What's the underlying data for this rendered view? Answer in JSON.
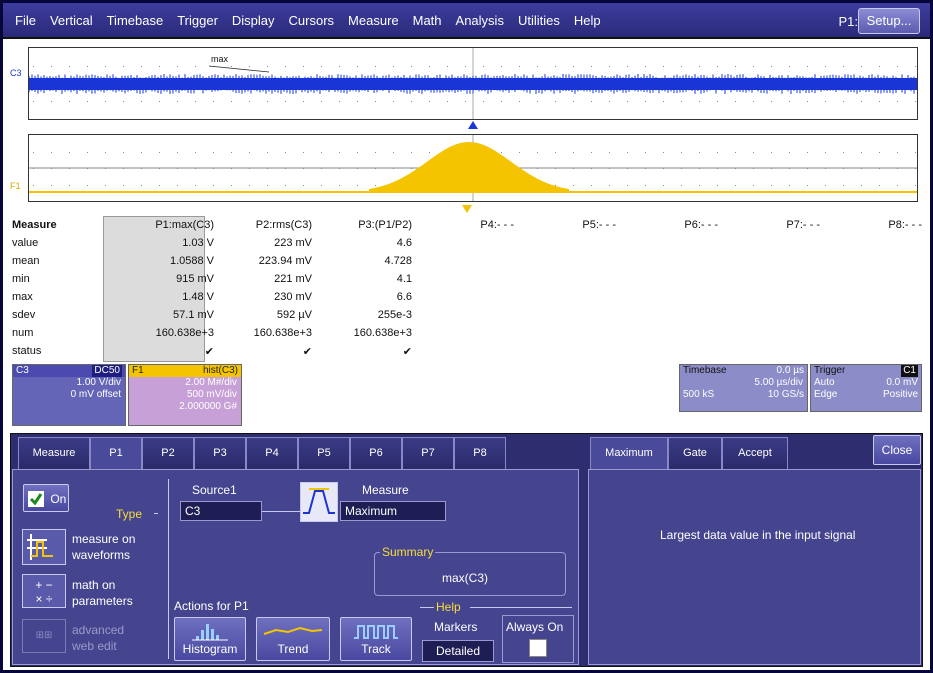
{
  "menu": {
    "items": [
      "File",
      "Vertical",
      "Timebase",
      "Trigger",
      "Display",
      "Cursors",
      "Measure",
      "Math",
      "Analysis",
      "Utilities",
      "Help"
    ],
    "p1_label": "P1:",
    "setup_label": "Setup..."
  },
  "traces": {
    "c3_label": "C3",
    "f1_label": "F1",
    "max_annotation": "max"
  },
  "measure_table": {
    "header_label": "Measure",
    "columns": [
      "P1:max(C3)",
      "P2:rms(C3)",
      "P3:(P1/P2)",
      "P4:- - -",
      "P5:- - -",
      "P6:- - -",
      "P7:- - -",
      "P8:- - -"
    ],
    "rows": [
      {
        "label": "value",
        "cells": [
          "1.03 V",
          "223 mV",
          "4.6"
        ]
      },
      {
        "label": "mean",
        "cells": [
          "1.0588 V",
          "223.94 mV",
          "4.728"
        ]
      },
      {
        "label": "min",
        "cells": [
          "915 mV",
          "221 mV",
          "4.1"
        ]
      },
      {
        "label": "max",
        "cells": [
          "1.48 V",
          "230 mV",
          "6.6"
        ]
      },
      {
        "label": "sdev",
        "cells": [
          "57.1 mV",
          "592 µV",
          "255e-3"
        ]
      },
      {
        "label": "num",
        "cells": [
          "160.638e+3",
          "160.638e+3",
          "160.638e+3"
        ]
      },
      {
        "label": "status",
        "cells": [
          "✔",
          "✔",
          "✔"
        ]
      }
    ]
  },
  "c3_descriptor": {
    "name": "C3",
    "coupling": "DC50",
    "line1": "1.00 V/div",
    "line2": "0 mV offset",
    "color": "#6565b8"
  },
  "f1_descriptor": {
    "name": "F1",
    "func": "hist(C3)",
    "line1": "2.00 M#/div",
    "line2": "500 mV/div",
    "line3": "2.000000 G#",
    "color": "#c8a0d8"
  },
  "timebase": {
    "label": "Timebase",
    "delay": "0.0 µs",
    "tdiv": "5.00 µs/div",
    "samples": "500 kS",
    "rate": "10 GS/s"
  },
  "trigger": {
    "label": "Trigger",
    "source": "C1",
    "mode": "Auto",
    "level": "0.0 mV",
    "type": "Edge",
    "slope": "Positive"
  },
  "tabs": [
    "Measure",
    "P1",
    "P2",
    "P3",
    "P4",
    "P5",
    "P6",
    "P7",
    "P8"
  ],
  "right_tabs": [
    "Maximum",
    "Gate",
    "Accept"
  ],
  "close_label": "Close",
  "p1_panel": {
    "on_label": "On",
    "type_label": "Type",
    "measure_on": "measure on",
    "waveforms": "waveforms",
    "math_on": "math on",
    "parameters": "parameters",
    "advanced": "advanced",
    "web_edit": "web edit",
    "source1_label": "Source1",
    "source1_value": "C3",
    "measure_label": "Measure",
    "measure_value": "Maximum",
    "summary_label": "Summary",
    "summary_value": "max(C3)",
    "actions_label": "Actions for P1",
    "help_label": "Help",
    "markers_label": "Markers",
    "markers_value": "Detailed",
    "always_on_label": "Always On",
    "histogram_label": "Histogram",
    "trend_label": "Trend",
    "track_label": "Track"
  },
  "maximum_help": "Largest data value in the input signal",
  "colors": {
    "c3_trace": "#1a35d6",
    "f1_trace": "#f5c400",
    "panel": "#2d2d70",
    "menubar": "#2a2a7a"
  }
}
